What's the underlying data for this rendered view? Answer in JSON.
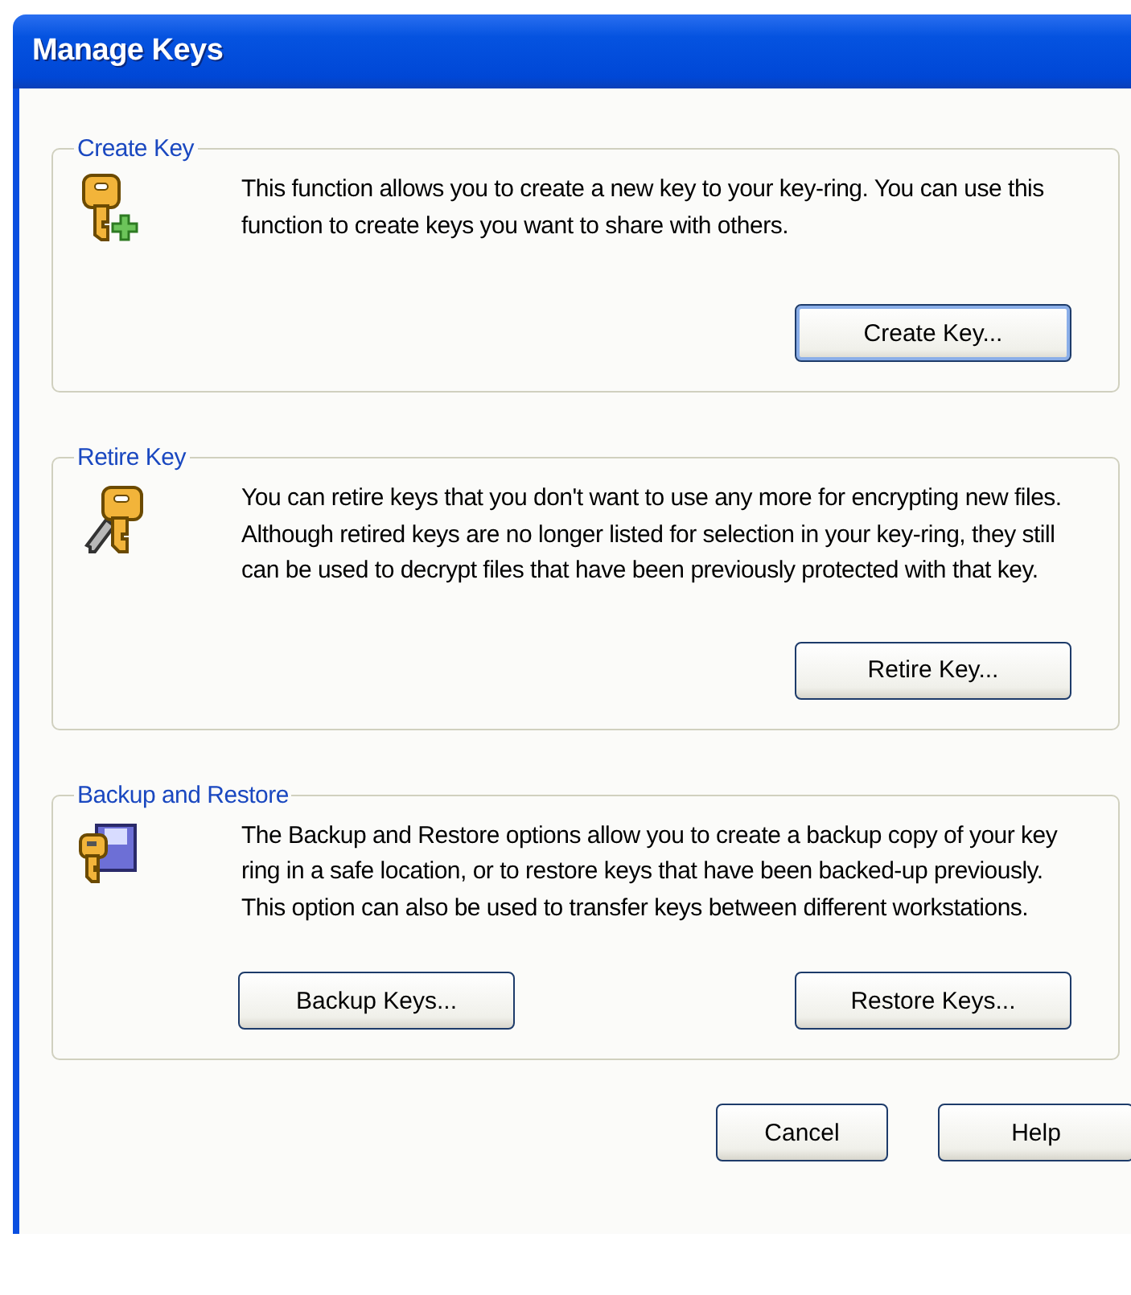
{
  "window": {
    "title": "Manage Keys"
  },
  "groups": [
    {
      "kind": "create",
      "title": "Create Key",
      "description": "This function allows you to create a new key to your key-ring. You can use this function to create keys you want to share with others.",
      "buttons": [
        {
          "label": "Create Key...",
          "focused": true
        }
      ]
    },
    {
      "kind": "retire",
      "title": "Retire Key",
      "description": "You can retire keys that you don't want to use any more for encrypting new files. Although retired keys are no longer listed for selection in your key-ring, they still can be used to decrypt files that have been previously protected with that key.",
      "buttons": [
        {
          "label": "Retire Key...",
          "focused": false
        }
      ]
    },
    {
      "kind": "backup",
      "title": "Backup and Restore",
      "description": "The Backup and Restore options allow you to create a backup copy of your key ring in a safe location, or to restore keys that have been backed-up previously. This option can also be used to transfer keys between different workstations.",
      "buttons": [
        {
          "label": "Backup Keys...",
          "focused": false
        },
        {
          "label": "Restore Keys...",
          "focused": false
        }
      ]
    }
  ],
  "footer_buttons": [
    {
      "label": "Cancel",
      "focused": false
    },
    {
      "label": "Help",
      "focused": false
    }
  ]
}
